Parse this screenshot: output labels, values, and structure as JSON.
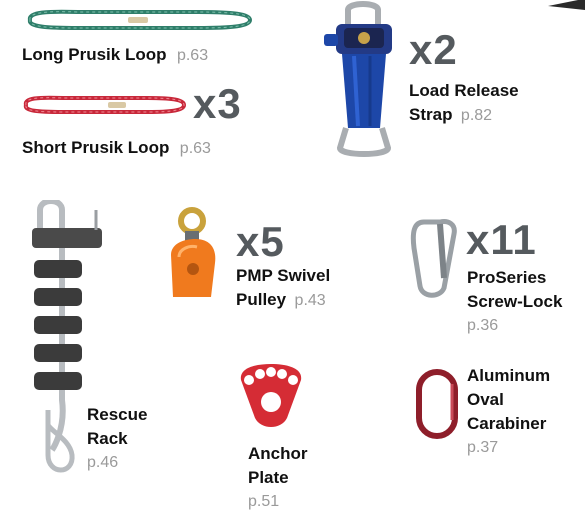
{
  "colors": {
    "quantity_gray": "#555a5e",
    "page_ref_gray": "#9a9a9a",
    "rope_green": "#2f7e6a",
    "rope_red": "#c8283a",
    "strap_blue": "#1d47a8",
    "pulley_orange": "#f07a1e",
    "anchor_red": "#d52c35",
    "carabiner_red": "#8e1e2a",
    "metal": "#b8bcc0"
  },
  "items": {
    "long_prusik": {
      "name": "Long Prusik Loop",
      "page": "p.63",
      "icon": "green-rope-loop-icon"
    },
    "short_prusik": {
      "name": "Short Prusik Loop",
      "page": "p.63",
      "qty": "x3",
      "icon": "red-rope-loop-icon"
    },
    "load_release": {
      "name_line1": "Load Release",
      "name_line2": "Strap",
      "page": "p.82",
      "qty": "x2",
      "icon": "load-release-strap-icon"
    },
    "rescue_rack": {
      "name_line1": "Rescue",
      "name_line2": "Rack",
      "page": "p.46",
      "icon": "rescue-rack-icon"
    },
    "swivel_pulley": {
      "name_line1": "PMP Swivel",
      "name_line2": "Pulley",
      "page": "p.43",
      "qty": "x5",
      "icon": "swivel-pulley-icon"
    },
    "screw_lock": {
      "name_line1": "ProSeries",
      "name_line2": "Screw-Lock",
      "page": "p.36",
      "qty": "x11",
      "icon": "screw-lock-carabiner-icon"
    },
    "anchor_plate": {
      "name_line1": "Anchor",
      "name_line2": "Plate",
      "page": "p.51",
      "icon": "anchor-plate-icon"
    },
    "oval_carabiner": {
      "name_line1": "Aluminum",
      "name_line2": "Oval",
      "name_line3": "Carabiner",
      "page": "p.37",
      "icon": "oval-carabiner-icon"
    }
  }
}
